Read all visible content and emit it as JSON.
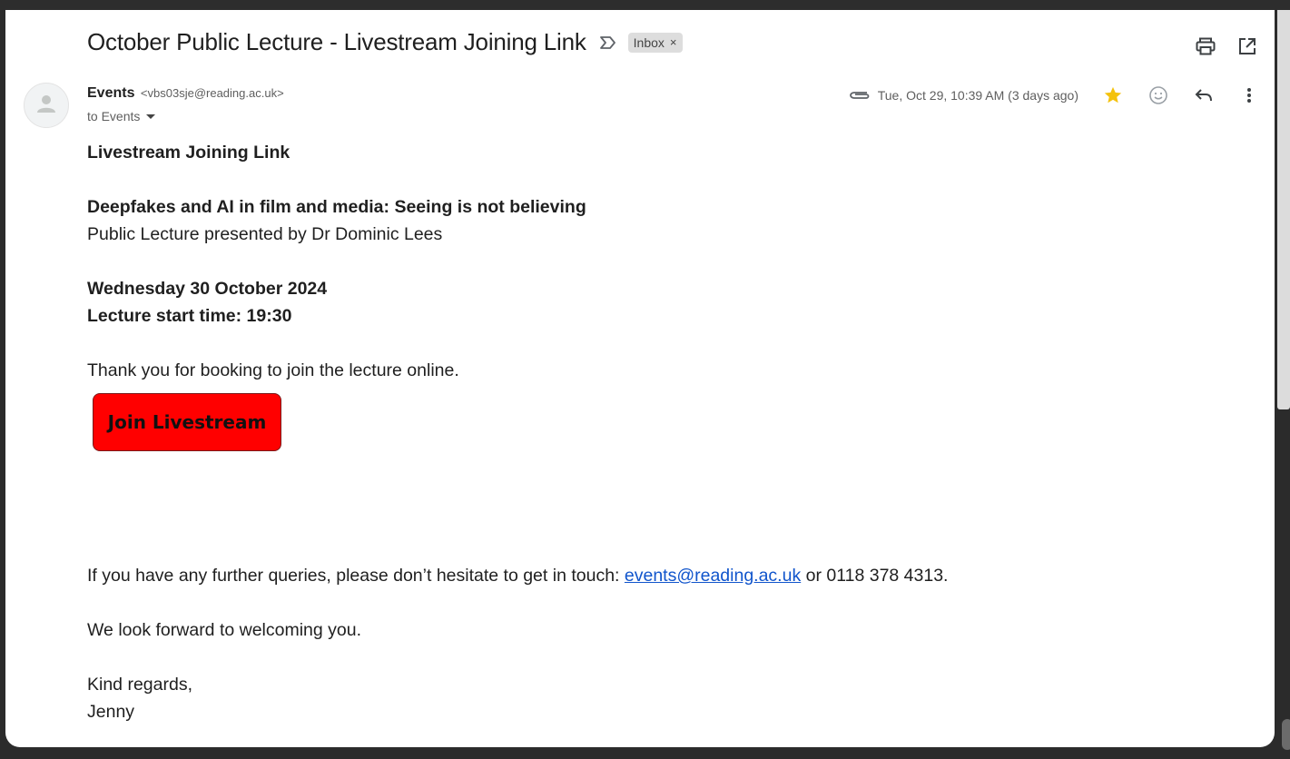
{
  "email": {
    "subject": "October Public Lecture - Livestream Joining Link",
    "label_chip": "Inbox",
    "label_chip_close": "×",
    "sender_name": "Events",
    "sender_email": "<vbs03sje@reading.ac.uk>",
    "to_line": "to Events",
    "date": "Tue, Oct 29, 10:39 AM (3 days ago)"
  },
  "icons": {
    "important": "importance-marker-icon",
    "print": "print-icon",
    "open_new_window": "open-in-new-window-icon",
    "attachment": "paperclip-icon",
    "star": "star-icon",
    "emoji": "emoji-reaction-icon",
    "reply": "reply-icon",
    "more": "more-vertical-icon",
    "avatar": "person-avatar-icon",
    "dropdown": "caret-down-icon"
  },
  "colors": {
    "star": "#f4c20d",
    "join_button": "#ff0000",
    "link": "#1155cc"
  },
  "body": {
    "heading": "Livestream Joining Link",
    "lecture_title": "Deepfakes and AI in film and media: Seeing is not believing",
    "presenter": "Public Lecture presented by Dr Dominic Lees",
    "date_line": "Wednesday 30 October 2024",
    "start_time": "Lecture start time: 19:30",
    "thanks": "Thank you for booking to join the lecture online.",
    "join_button": "Join Livestream",
    "queries_prefix": "If you have any further queries, please don’t hesitate to get in touch: ",
    "queries_link": "events@reading.ac.uk",
    "queries_suffix": " or 0118 378 4313.",
    "welcome": "We look forward to welcoming you.",
    "closing": "Kind regards,",
    "signature": "Jenny"
  }
}
